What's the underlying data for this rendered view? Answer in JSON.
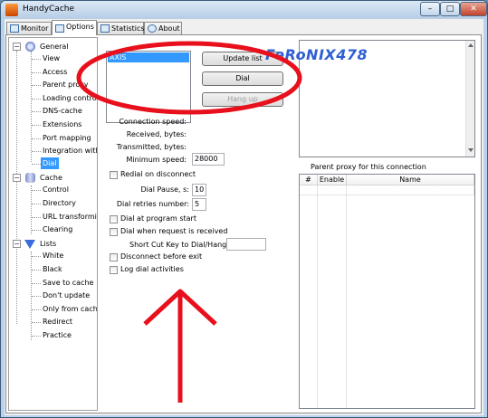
{
  "window": {
    "title": "HandyCache",
    "min": "–",
    "max": "□",
    "close": "✕"
  },
  "tabs": [
    {
      "label": "Monitor",
      "icon": "monitor-icon"
    },
    {
      "label": "Options",
      "icon": "options-icon"
    },
    {
      "label": "Statistics",
      "icon": "statistics-icon"
    },
    {
      "label": "About",
      "icon": "info-icon"
    }
  ],
  "tree": {
    "collapse_glyph": "−",
    "groups": [
      {
        "label": "General",
        "icon": "gear-icon",
        "items": [
          "View",
          "Access",
          "Parent proxy",
          "Loading control",
          "DNS-cache",
          "Extensions",
          "Port mapping",
          "Integration with IE",
          "Dial"
        ]
      },
      {
        "label": "Cache",
        "icon": "database-icon",
        "items": [
          "Control",
          "Directory",
          "URL transforming",
          "Clearing"
        ]
      },
      {
        "label": "Lists",
        "icon": "filter-icon",
        "items": [
          "White",
          "Black",
          "Save to cache",
          "Don't update",
          "Only from cache",
          "Redirect",
          "Practice"
        ]
      }
    ],
    "selected": "Dial"
  },
  "dial": {
    "connections": [
      "AXIS"
    ],
    "update_list": "Update list",
    "dial": "Dial",
    "hang_up": "Hang up",
    "connection_speed_label": "Connection speed:",
    "received_label": "Received, bytes:",
    "transmitted_label": "Transmitted, bytes:",
    "min_speed_label": "Minimum speed:",
    "min_speed_value": "28000",
    "redial_label": "Redial on disconnect",
    "pause_label": "Dial Pause, s:",
    "pause_value": "10",
    "retries_label": "Dial retries number:",
    "retries_value": "5",
    "dial_at_start_label": "Dial at program start",
    "dial_on_request_label": "Dial when request is received",
    "shortcut_label": "Short Cut Key to Dial/Hang Up:",
    "shortcut_value": "",
    "disconnect_label": "Disconnect before exit",
    "log_label": "Log dial activities"
  },
  "proxy": {
    "label": "Parent proxy for this connection",
    "columns": [
      "#",
      "Enable",
      "Name"
    ]
  },
  "watermark": "FeRoNIX478",
  "colors": {
    "annotation": "#e8101c",
    "selection": "#3399ff",
    "watermark": "#2f5fd0"
  }
}
